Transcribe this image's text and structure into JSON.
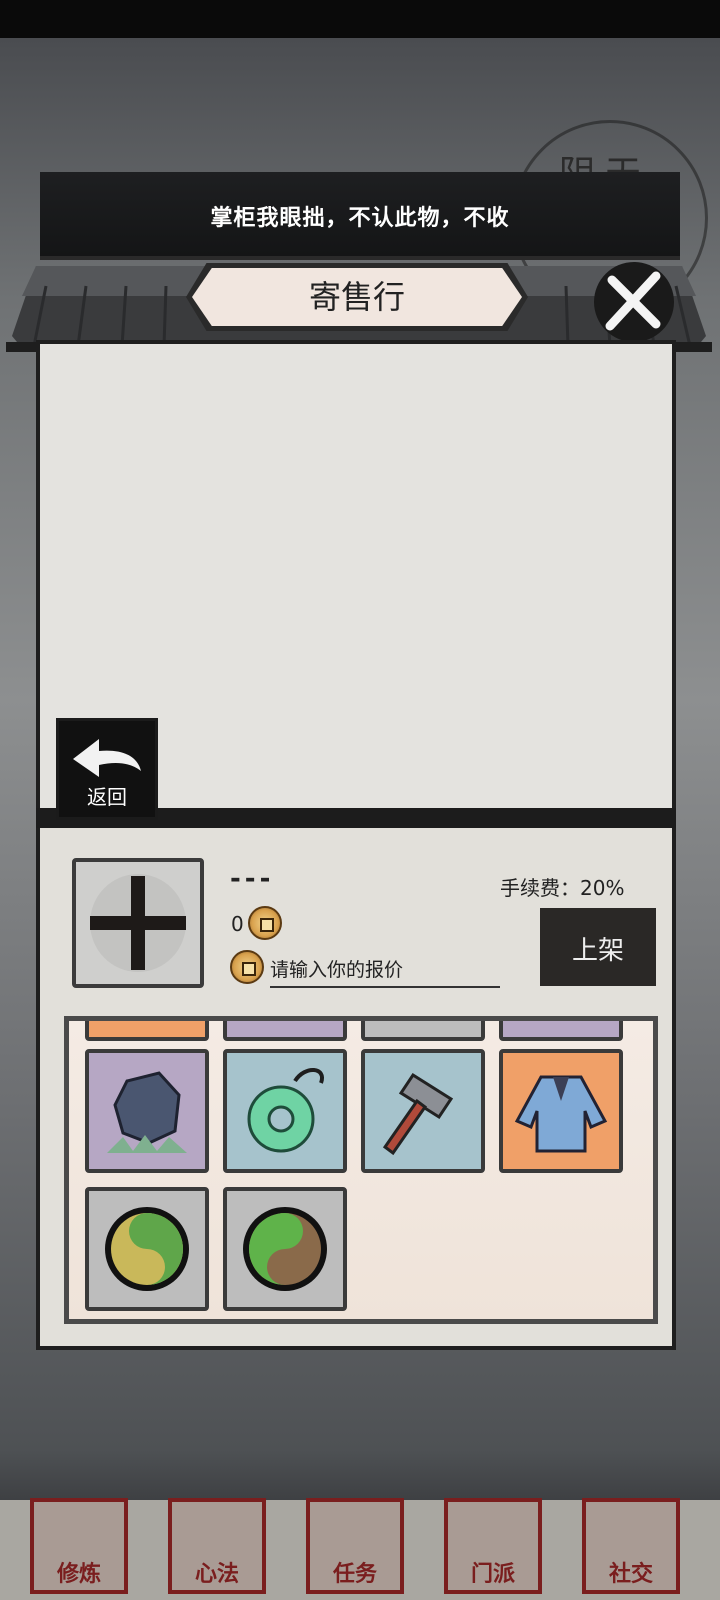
{
  "weather": {
    "label": "阴天"
  },
  "banner": {
    "text": "掌柜我眼拙，不认此物，不收"
  },
  "title": "寄售行",
  "back": {
    "label": "返回"
  },
  "selected_item": {
    "name": "---",
    "quantity": "0",
    "fee_label": "手续费：20%",
    "price_placeholder": "请输入你的报价",
    "list_button": "上架"
  },
  "inventory": {
    "items": [
      {
        "name": "stone-ore",
        "quality": "purple"
      },
      {
        "name": "jade-ring-pendant",
        "quality": "blue"
      },
      {
        "name": "war-hammer",
        "quality": "blue"
      },
      {
        "name": "blue-robe",
        "quality": "orange"
      },
      {
        "name": "green-yellow-orb",
        "quality": "gray"
      },
      {
        "name": "green-brown-orb",
        "quality": "gray"
      }
    ]
  },
  "nav": [
    {
      "label": "修炼",
      "icon": "cultivate-icon"
    },
    {
      "label": "心法",
      "icon": "scroll-icon"
    },
    {
      "label": "任务",
      "icon": "task-icon"
    },
    {
      "label": "门派",
      "icon": "sect-icon"
    },
    {
      "label": "社交",
      "icon": "social-icon"
    }
  ]
}
